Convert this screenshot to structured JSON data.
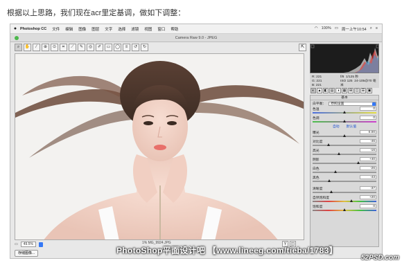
{
  "intro_text": "根据以上思路，我们现在acr里定基调，做如下调整：",
  "menubar": {
    "apple": "",
    "items": [
      "Photoshop CC",
      "文件",
      "编辑",
      "图像",
      "图层",
      "文字",
      "选择",
      "滤镜",
      "视图",
      "窗口",
      "帮助"
    ],
    "status": [
      "100%",
      "周一上午10:54"
    ]
  },
  "window_title": "Camera Raw 9.0 - JPEG",
  "toolbar_icons": [
    "zoom-icon",
    "hand-icon",
    "white-balance-icon",
    "color-sampler-icon",
    "target-adjust-icon",
    "crop-icon",
    "straighten-icon",
    "spot-removal-icon",
    "red-eye-icon",
    "adjustment-brush-icon",
    "graduated-filter-icon",
    "radial-filter-icon",
    "preferences-icon",
    "rotate-ccw-icon",
    "rotate-cw-icon"
  ],
  "toolbar_glyphs": [
    "⌕",
    "✋",
    "⁄",
    "⊕",
    "⊙",
    "⌗",
    "⟋",
    "✎",
    "◎",
    "✐",
    "▭",
    "◯",
    "≡",
    "↺",
    "↻"
  ],
  "fullscreen_glyph": "⇱",
  "bottom": {
    "zoom": "49.5%",
    "filename": "1% MG_9924.JPG",
    "save_label": "存储图像..."
  },
  "camera_info": {
    "rgb": [
      "R:",
      "G:",
      "B:"
    ],
    "rgb_values": [
      "221",
      "221",
      "221"
    ],
    "f": "f/8",
    "shutter": "1/125 秒",
    "iso": "ISO 125",
    "lens": "24-105@70 毫米"
  },
  "panel_tabs": [
    "◐",
    "▲",
    "◧",
    "▤",
    "◑",
    "▦",
    "⊞",
    "◫",
    "☰",
    "▣"
  ],
  "panel": {
    "title": "基本",
    "wb_label": "白平衡：",
    "wb_value": "原照设置",
    "links": [
      "自动",
      "默认值"
    ],
    "sliders": [
      {
        "label": "色温",
        "value": "0",
        "pos": 0.5,
        "track": "temp"
      },
      {
        "label": "色调",
        "value": "0",
        "pos": 0.5,
        "track": "tint"
      },
      {
        "label": "曝光",
        "value": "0.00",
        "pos": 0.5,
        "track": "grey",
        "gap": true
      },
      {
        "label": "对比度",
        "value": "-46",
        "pos": 0.27,
        "track": "grey"
      },
      {
        "label": "高光",
        "value": "-16",
        "pos": 0.42,
        "track": "grey"
      },
      {
        "label": "阴影",
        "value": "+40",
        "pos": 0.7,
        "track": "grey"
      },
      {
        "label": "白色",
        "value": "-26",
        "pos": 0.37,
        "track": "grey"
      },
      {
        "label": "黑色",
        "value": "-43",
        "pos": 0.28,
        "track": "grey"
      },
      {
        "label": "清晰度",
        "value": "-37",
        "pos": 0.31,
        "track": "grey",
        "gap": true
      },
      {
        "label": "自然饱和度",
        "value": "+20",
        "pos": 0.6,
        "track": "sat"
      },
      {
        "label": "饱和度",
        "value": "0",
        "pos": 0.5,
        "track": "sat"
      }
    ]
  },
  "watermark": "PhotoShop平面设计吧 【www.lineeg.com/tieba/1783】",
  "site_logo": "52PSD.com",
  "colors": {
    "accent": "#3478f6",
    "histogram_bg": "#1c1c1c",
    "link": "#1a4fd0"
  }
}
